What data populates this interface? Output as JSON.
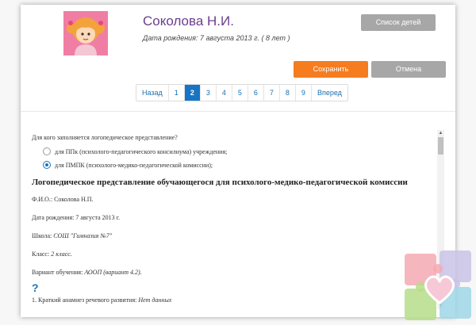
{
  "header": {
    "child_name": "Соколова Н.И.",
    "birth_line": "Дата рождения: 7 августа 2013 г. ( 8 лет )",
    "avatar_icon": "girl-avatar-icon",
    "children_list_label": "Список детей",
    "save_label": "Сохранить",
    "cancel_label": "Отмена"
  },
  "pagination": {
    "prev_label": "Назад",
    "next_label": "Вперед",
    "pages": [
      "1",
      "2",
      "3",
      "4",
      "5",
      "6",
      "7",
      "8",
      "9"
    ],
    "current": "2"
  },
  "content": {
    "question": "Для кого заполняется логопедическое представление?",
    "options": [
      {
        "label": "для ППк (психолого-педагогического консилиума) учреждения;",
        "checked": false
      },
      {
        "label": "для ПМПК (психолого-медико-педагогической комиссии);",
        "checked": true
      }
    ],
    "doc_title": "Логопедическое представление обучающегося для психолого-медико-педагогической комиссии",
    "fio_label": "Ф.И.О.: Соколова Н.П.",
    "birth_label": "Дата рождения: 7 августа 2013 г.",
    "school_label": "Школа:",
    "school_value": "СОШ \"Гимназия №7\"",
    "class_label": "Класс:",
    "class_value": "2 класс.",
    "variant_label": "Вариант обучения:",
    "variant_value": "АООП (вариант 4.2).",
    "help_icon": "?",
    "anamnesis_label": "1. Краткий анамнез речевого развития:",
    "anamnesis_value": "Нет данных"
  },
  "colors": {
    "accent_blue": "#1874c4",
    "save_orange": "#f57c1f",
    "gray_button": "#a7a7a7",
    "name_purple": "#6b3d8f"
  }
}
